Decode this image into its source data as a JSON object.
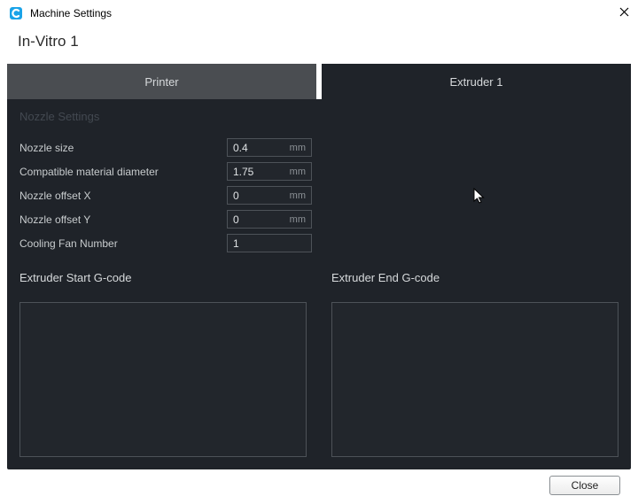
{
  "window": {
    "title": "Machine Settings"
  },
  "machine_name": "In-Vitro 1",
  "tabs": {
    "printer": "Printer",
    "extruder1": "Extruder 1",
    "active": "extruder1"
  },
  "section_header": "Nozzle Settings",
  "fields": {
    "nozzle_size": {
      "label": "Nozzle size",
      "value": "0.4",
      "unit": "mm"
    },
    "material_dia": {
      "label": "Compatible material diameter",
      "value": "1.75",
      "unit": "mm"
    },
    "offset_x": {
      "label": "Nozzle offset X",
      "value": "0",
      "unit": "mm"
    },
    "offset_y": {
      "label": "Nozzle offset Y",
      "value": "0",
      "unit": "mm"
    },
    "fan_number": {
      "label": "Cooling Fan Number",
      "value": "1",
      "unit": ""
    }
  },
  "gcode": {
    "start": {
      "label": "Extruder Start G-code",
      "value": ""
    },
    "end": {
      "label": "Extruder End G-code",
      "value": ""
    }
  },
  "buttons": {
    "close": "Close"
  }
}
